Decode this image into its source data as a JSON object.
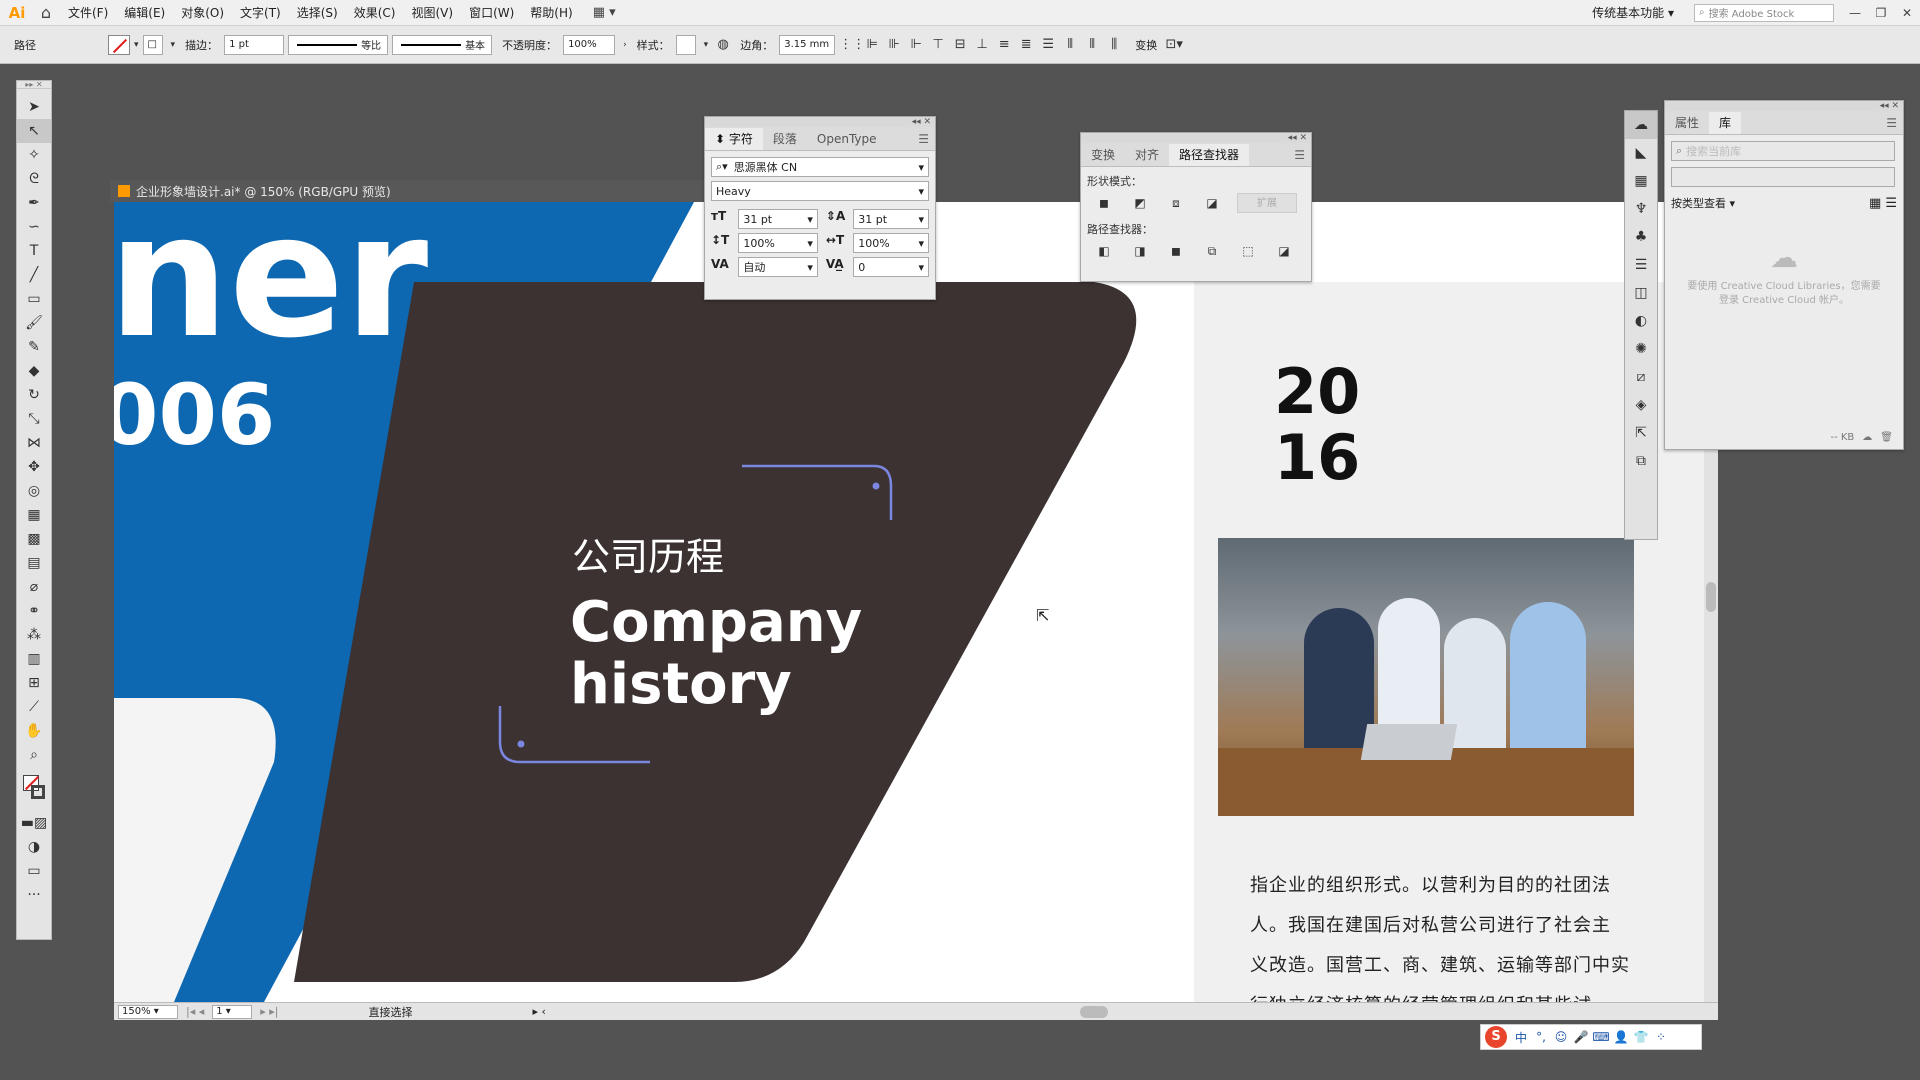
{
  "app": {
    "logo": "Ai",
    "menu": [
      "文件(F)",
      "编辑(E)",
      "对象(O)",
      "文字(T)",
      "选择(S)",
      "效果(C)",
      "视图(V)",
      "窗口(W)",
      "帮助(H)"
    ],
    "workspace": "传统基本功能",
    "stock_search_placeholder": "搜索 Adobe Stock",
    "window_buttons": [
      "—",
      "❐",
      "✕"
    ]
  },
  "control_bar": {
    "selection_label": "路径",
    "stroke_label": "描边：",
    "stroke_weight": "1 pt",
    "profile_label": "等比",
    "brush_label": "基本",
    "opacity_label": "不透明度：",
    "opacity_value": "100%",
    "style_label": "样式：",
    "corner_label": "边角：",
    "corner_value": "3.15 mm",
    "transform_label": "变换"
  },
  "toolbar": {
    "tools": [
      {
        "name": "selection-tool",
        "glyph": "➤"
      },
      {
        "name": "direct-selection-tool",
        "glyph": "↖",
        "active": true
      },
      {
        "name": "magic-wand-tool",
        "glyph": "✧"
      },
      {
        "name": "lasso-tool",
        "glyph": "ᘓ"
      },
      {
        "name": "pen-tool",
        "glyph": "✒"
      },
      {
        "name": "curvature-tool",
        "glyph": "∽"
      },
      {
        "name": "type-tool",
        "glyph": "T"
      },
      {
        "name": "line-tool",
        "glyph": "╱"
      },
      {
        "name": "rectangle-tool",
        "glyph": "▭"
      },
      {
        "name": "paintbrush-tool",
        "glyph": "🖌"
      },
      {
        "name": "pencil-tool",
        "glyph": "✎"
      },
      {
        "name": "eraser-tool",
        "glyph": "◆"
      },
      {
        "name": "rotate-tool",
        "glyph": "↻"
      },
      {
        "name": "scale-tool",
        "glyph": "⤡"
      },
      {
        "name": "width-tool",
        "glyph": "⋈"
      },
      {
        "name": "puppet-warp-tool",
        "glyph": "✥"
      },
      {
        "name": "shape-builder-tool",
        "glyph": "◎"
      },
      {
        "name": "perspective-grid-tool",
        "glyph": "▦"
      },
      {
        "name": "mesh-tool",
        "glyph": "▩"
      },
      {
        "name": "gradient-tool",
        "glyph": "▤"
      },
      {
        "name": "eyedropper-tool",
        "glyph": "⌀"
      },
      {
        "name": "blend-tool",
        "glyph": "⚭"
      },
      {
        "name": "symbol-sprayer-tool",
        "glyph": "⁂"
      },
      {
        "name": "column-graph-tool",
        "glyph": "▥"
      },
      {
        "name": "artboard-tool",
        "glyph": "⊞"
      },
      {
        "name": "slice-tool",
        "glyph": "⟋"
      },
      {
        "name": "hand-tool",
        "glyph": "✋"
      },
      {
        "name": "zoom-tool",
        "glyph": "⌕"
      }
    ],
    "more": "···"
  },
  "document": {
    "tab_title": "企业形象墙设计.ai* @ 150% (RGB/GPU 预览)",
    "zoom": "150%",
    "page": "1",
    "status_tool": "直接选择"
  },
  "artwork": {
    "big_word": "ner",
    "big_number": "006",
    "heading_cn": "公司历程",
    "heading_en_line1": "Company",
    "heading_en_line2": "history",
    "year_line1": "20",
    "year_line2": "16",
    "body_lines": [
      "指企业的组织形式。以营利为目的的社团法",
      "人。我国在建国后对私营公司进行了社会主",
      "义改造。国营工、商、建筑、运输等部门中实",
      "行独立经济核算的经营管理组织和某些试"
    ],
    "colors": {
      "blue": "#0d68b1",
      "dark": "#3b3231",
      "light_grey": "#f0f0f0",
      "corner_lines": "#7b86e0"
    }
  },
  "character_panel": {
    "tabs": [
      "字符",
      "段落",
      "OpenType"
    ],
    "font_family": "思源黑体 CN",
    "font_style": "Heavy",
    "font_size": "31 pt",
    "leading": "31 pt",
    "vertical_scale": "100%",
    "horizontal_scale": "100%",
    "kerning": "自动",
    "tracking": "0"
  },
  "pathfinder_panel": {
    "tabs": [
      "变换",
      "对齐",
      "路径查找器"
    ],
    "shape_modes_label": "形状模式：",
    "pathfinders_label": "路径查找器：",
    "expand_label": "扩展"
  },
  "library_panel": {
    "tabs": [
      "属性",
      "库"
    ],
    "search_placeholder": "搜索当前库",
    "view_by": "按类型查看",
    "message": "要使用 Creative Cloud Libraries，您需要登录 Creative Cloud 帐户。",
    "footer_kb": "-- KB"
  },
  "ime": {
    "logo": "S",
    "lang": "中",
    "icons": [
      "°,",
      "☺",
      "🎤",
      "⌨",
      "👤",
      "👕",
      "⁘"
    ]
  }
}
